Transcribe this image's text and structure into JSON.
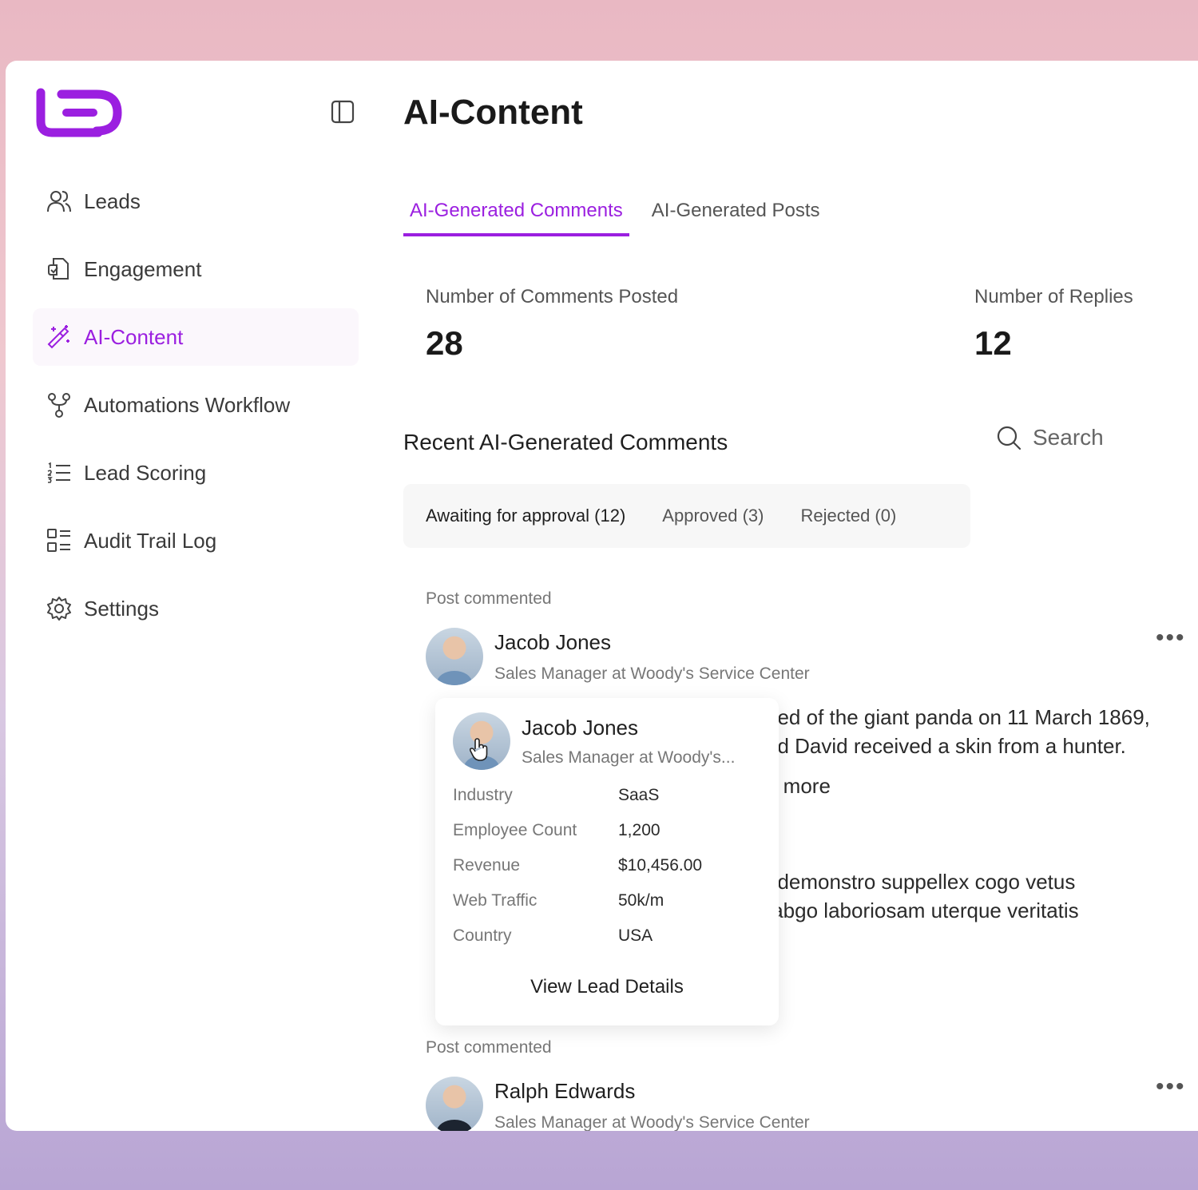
{
  "page": {
    "title": "AI-Content"
  },
  "sidebar": {
    "items": [
      {
        "label": "Leads",
        "icon": "users-icon"
      },
      {
        "label": "Engagement",
        "icon": "engagement-icon"
      },
      {
        "label": "AI-Content",
        "icon": "magic-wand-icon",
        "active": true
      },
      {
        "label": "Automations Workflow",
        "icon": "workflow-icon"
      },
      {
        "label": "Lead Scoring",
        "icon": "list-icon"
      },
      {
        "label": "Audit Trail Log",
        "icon": "audit-log-icon"
      },
      {
        "label": "Settings",
        "icon": "gear-icon"
      }
    ]
  },
  "tabs": [
    {
      "label": "AI-Generated Comments",
      "active": true
    },
    {
      "label": "AI-Generated Posts"
    }
  ],
  "stats": {
    "comments_posted": {
      "label": "Number of Comments Posted",
      "value": "28"
    },
    "replies": {
      "label": "Number of Replies",
      "value": "12"
    }
  },
  "recent": {
    "title": "Recent AI-Generated Comments",
    "search_label": "Search",
    "filters": [
      {
        "label": "Awaiting for approval (12)",
        "active": true
      },
      {
        "label": "Approved (3)"
      },
      {
        "label": "Rejected (0)"
      }
    ]
  },
  "posts": [
    {
      "label": "Post commented",
      "author": "Jacob Jones",
      "title": "Sales Manager at Woody's Service Center",
      "comment_line1": "ned of the giant panda on 11 March 1869,",
      "comment_line2": "nd David received a skin from a hunter.",
      "see_more": "e more",
      "comment2_line1": "; demonstro suppellex cogo vetus",
      "comment2_line2": "tabgo laboriosam uterque veritatis",
      "comment2_line3": "\""
    },
    {
      "label": "Post commented",
      "author": "Ralph Edwards",
      "title": "Sales Manager at Woody's Service Center"
    }
  ],
  "popover": {
    "author": "Jacob Jones",
    "title": "Sales Manager at Woody's...",
    "fields": [
      {
        "key": "Industry",
        "value": "SaaS"
      },
      {
        "key": "Employee Count",
        "value": "1,200"
      },
      {
        "key": "Revenue",
        "value": "$10,456.00"
      },
      {
        "key": "Web Traffic",
        "value": "50k/m"
      },
      {
        "key": "Country",
        "value": "USA"
      }
    ],
    "cta": "View Lead Details"
  },
  "colors": {
    "accent": "#9b1fe0",
    "active_bg": "#fbf7fc"
  }
}
